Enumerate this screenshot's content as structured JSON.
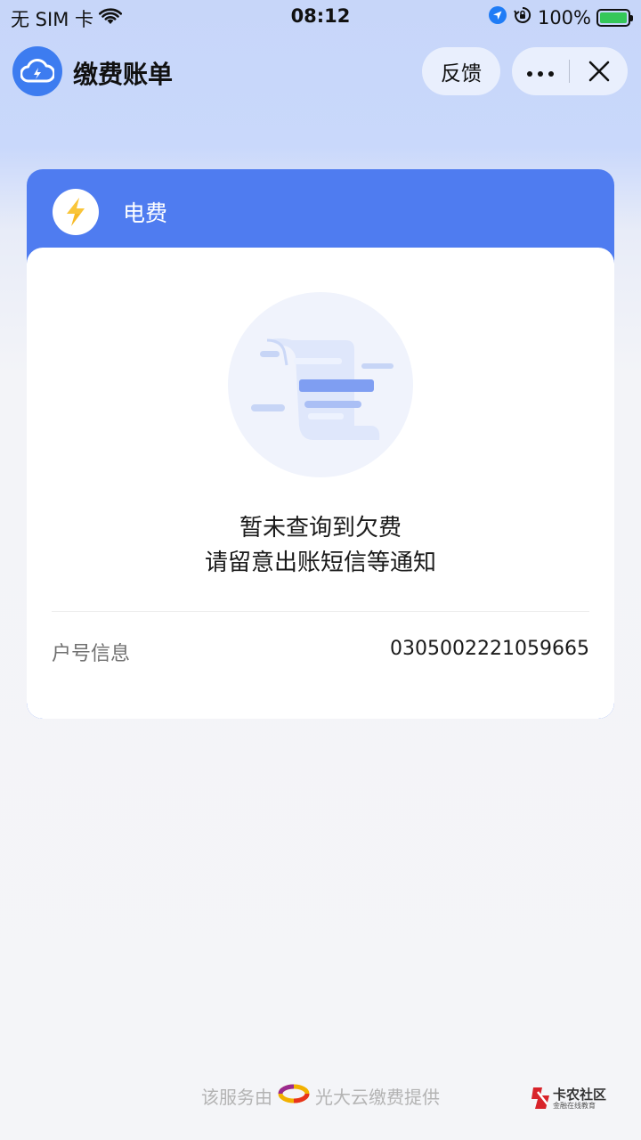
{
  "status_bar": {
    "carrier": "无 SIM 卡",
    "time": "08:12",
    "battery": "100%",
    "battery_level": 1.0
  },
  "nav": {
    "title": "缴费账单",
    "feedback_label": "反馈",
    "icons": [
      "cloud-bolt-icon",
      "more-icon",
      "close-icon"
    ]
  },
  "bill_card": {
    "title": "电费",
    "message_line1": "暂未查询到欠费",
    "message_line2": "请留意出账短信等通知",
    "account_label": "户号信息",
    "account_number": "0305002221059665",
    "accent_color": "#4f7cf0"
  },
  "footer": {
    "prefix": "该服务由",
    "provider": "光大云缴费提供"
  },
  "watermark": {
    "title": "卡农社区",
    "subtitle": "金融在线教育"
  }
}
